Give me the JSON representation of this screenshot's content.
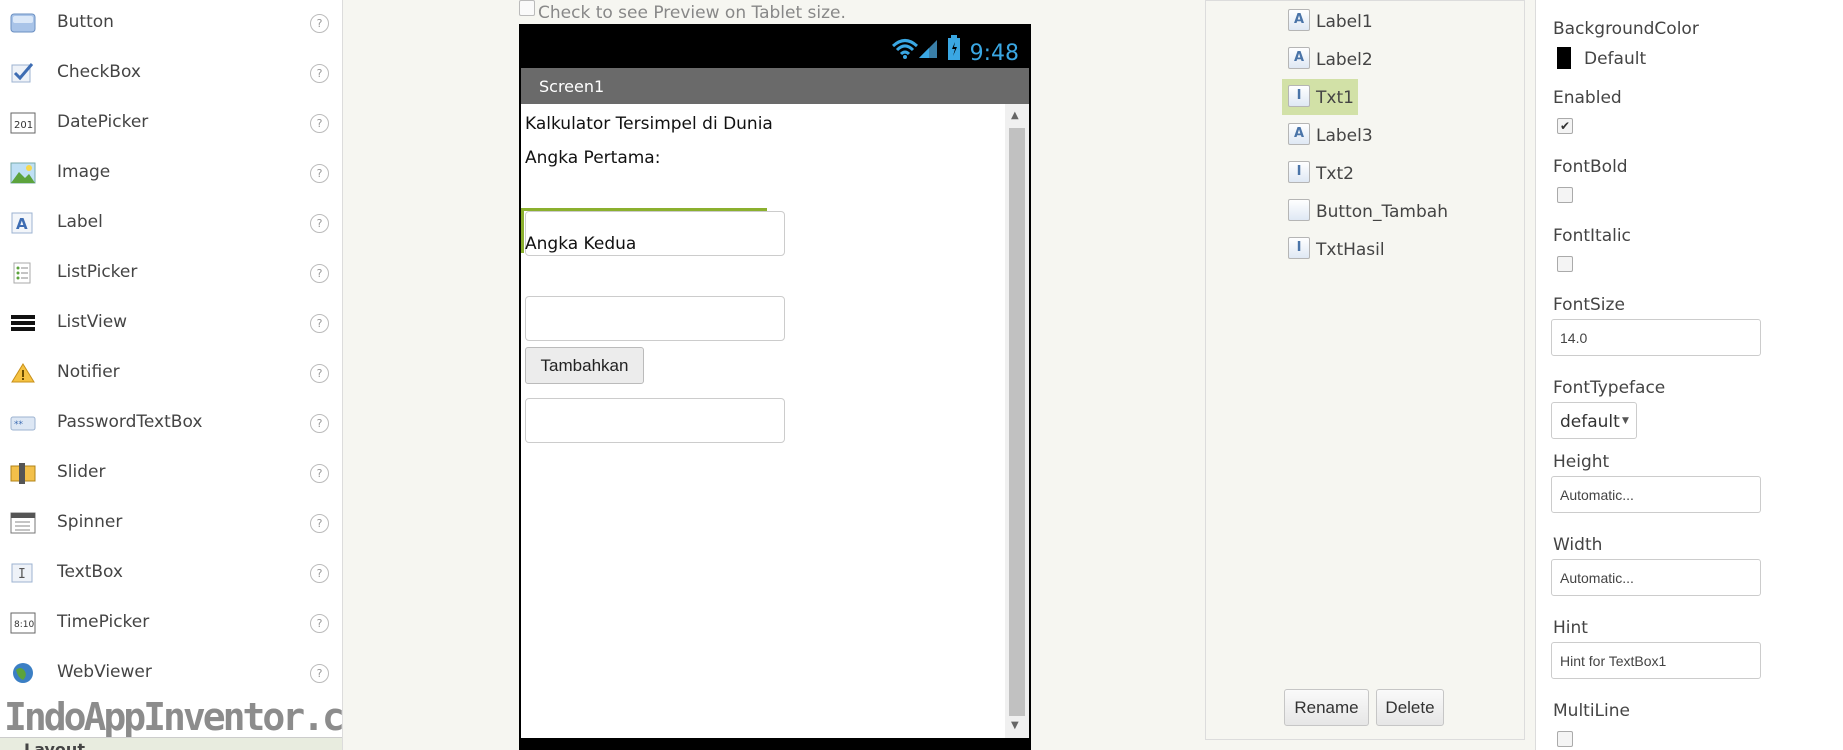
{
  "palette": {
    "items": [
      {
        "label": "Button",
        "icon": "button-icon"
      },
      {
        "label": "CheckBox",
        "icon": "checkbox-icon"
      },
      {
        "label": "DatePicker",
        "icon": "datepicker-icon"
      },
      {
        "label": "Image",
        "icon": "image-icon"
      },
      {
        "label": "Label",
        "icon": "label-icon"
      },
      {
        "label": "ListPicker",
        "icon": "listpicker-icon"
      },
      {
        "label": "ListView",
        "icon": "listview-icon"
      },
      {
        "label": "Notifier",
        "icon": "notifier-icon"
      },
      {
        "label": "PasswordTextBox",
        "icon": "passwordtextbox-icon"
      },
      {
        "label": "Slider",
        "icon": "slider-icon"
      },
      {
        "label": "Spinner",
        "icon": "spinner-icon"
      },
      {
        "label": "TextBox",
        "icon": "textbox-icon"
      },
      {
        "label": "TimePicker",
        "icon": "timepicker-icon"
      },
      {
        "label": "WebViewer",
        "icon": "webviewer-icon"
      }
    ],
    "help_glyph": "?",
    "watermark": "IndoAppInventor.com",
    "layout_label": "Layout"
  },
  "viewer": {
    "preview_label": "Check to see Preview on Tablet size.",
    "clock": "9:48",
    "screen_title": "Screen1",
    "label1": "Kalkulator Tersimpel di Dunia",
    "label2": "Angka Pertama:",
    "label3": "Angka Kedua",
    "button_tambah": "Tambahkan"
  },
  "components": {
    "items": [
      {
        "label": "Label1",
        "icon": "A"
      },
      {
        "label": "Label2",
        "icon": "A"
      },
      {
        "label": "Txt1",
        "icon": "I"
      },
      {
        "label": "Label3",
        "icon": "A"
      },
      {
        "label": "Txt2",
        "icon": "I"
      },
      {
        "label": "Button_Tambah",
        "icon": ""
      },
      {
        "label": "TxtHasil",
        "icon": "I"
      }
    ],
    "rename": "Rename",
    "delete": "Delete"
  },
  "properties": {
    "background_color": {
      "title": "BackgroundColor",
      "value": "Default"
    },
    "enabled": {
      "title": "Enabled",
      "checked": "✔"
    },
    "font_bold": {
      "title": "FontBold"
    },
    "font_italic": {
      "title": "FontItalic"
    },
    "font_size": {
      "title": "FontSize",
      "value": "14.0"
    },
    "font_typeface": {
      "title": "FontTypeface",
      "value": "default"
    },
    "height": {
      "title": "Height",
      "value": "Automatic..."
    },
    "width": {
      "title": "Width",
      "value": "Automatic..."
    },
    "hint": {
      "title": "Hint",
      "value": "Hint for TextBox1"
    },
    "multiline": {
      "title": "MultiLine"
    }
  },
  "colors": {
    "selection": "#d2e1a7",
    "accent": "#8bb02e",
    "clock": "#3aa7e3"
  }
}
